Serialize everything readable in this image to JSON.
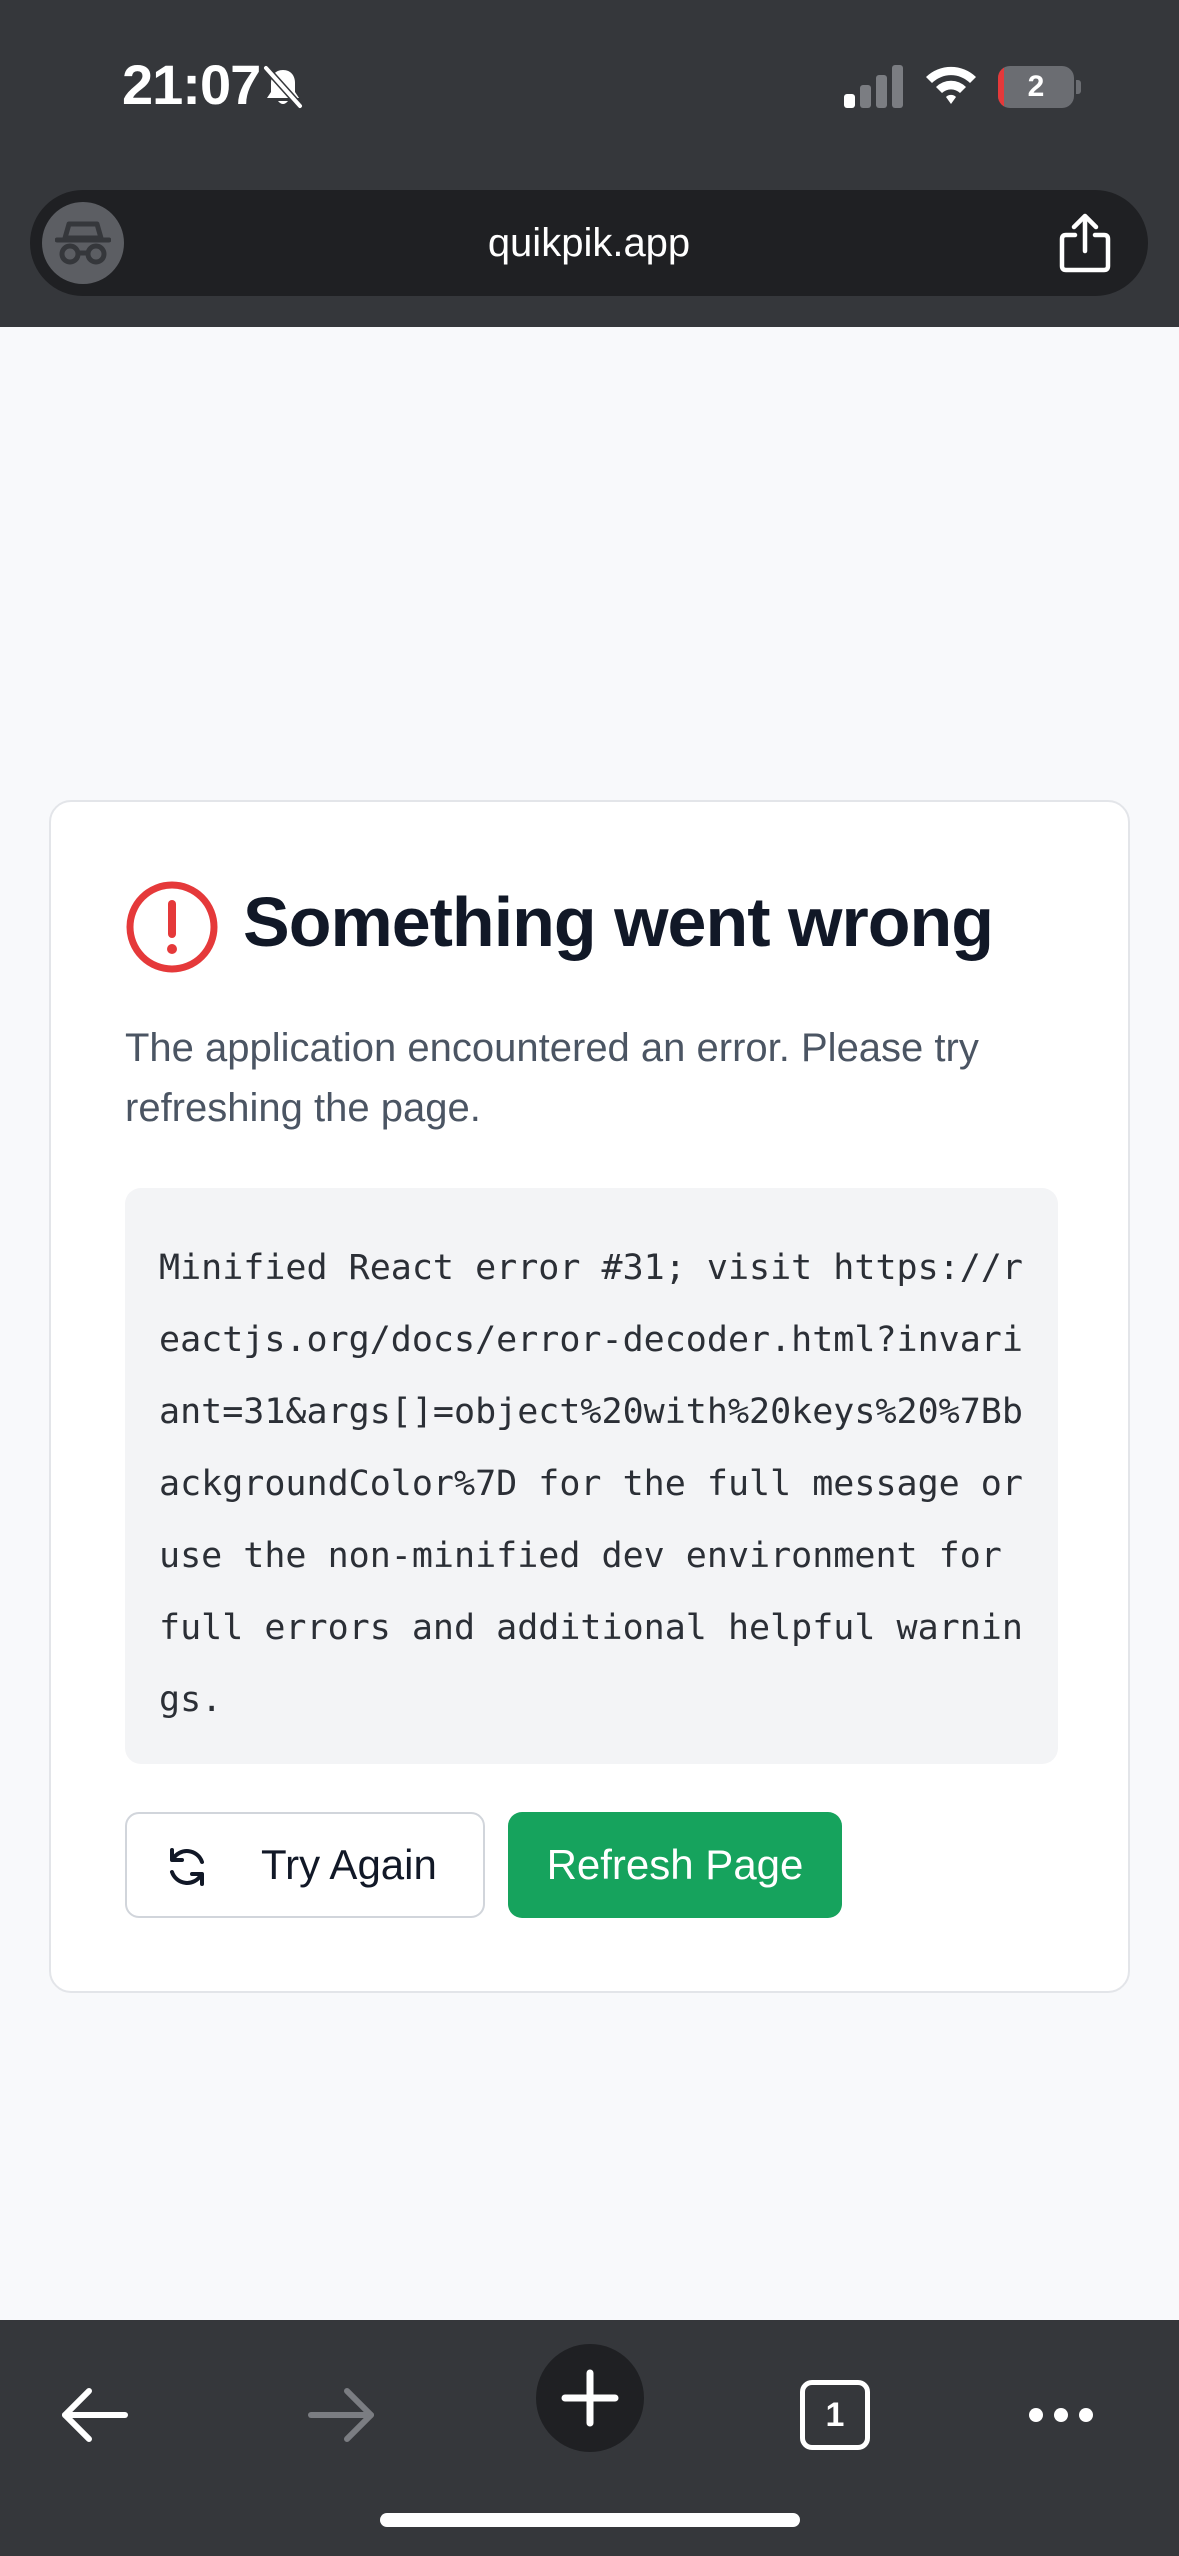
{
  "status_bar": {
    "time": "21:07",
    "battery_level": "2",
    "battery_fraction": 0.08,
    "icons": [
      "bell-slash-icon",
      "cellular-signal-icon",
      "wifi-icon",
      "battery-icon"
    ]
  },
  "browser": {
    "url": "quikpik.app",
    "mode": "incognito",
    "tab_count": "1",
    "icons": [
      "incognito-icon",
      "share-icon",
      "back-arrow-icon",
      "forward-arrow-icon",
      "plus-icon",
      "more-icon"
    ]
  },
  "error_card": {
    "title": "Something went wrong",
    "message": "The application encountered an error. Please try refreshing the page.",
    "error_detail": "Minified React error #31; visit https://reactjs.org/docs/error-decoder.html?invariant=31&args[]=object%20with%20keys%20%7BbackgroundColor%7D for the full message or use the non-minified dev environment for full errors and additional helpful warnings.",
    "try_again_label": "Try Again",
    "refresh_label": "Refresh Page"
  },
  "colors": {
    "chrome": "#35373b",
    "alert_red": "#e5393a",
    "refresh_green": "#16a35d",
    "page_bg": "#f8f9fb"
  }
}
